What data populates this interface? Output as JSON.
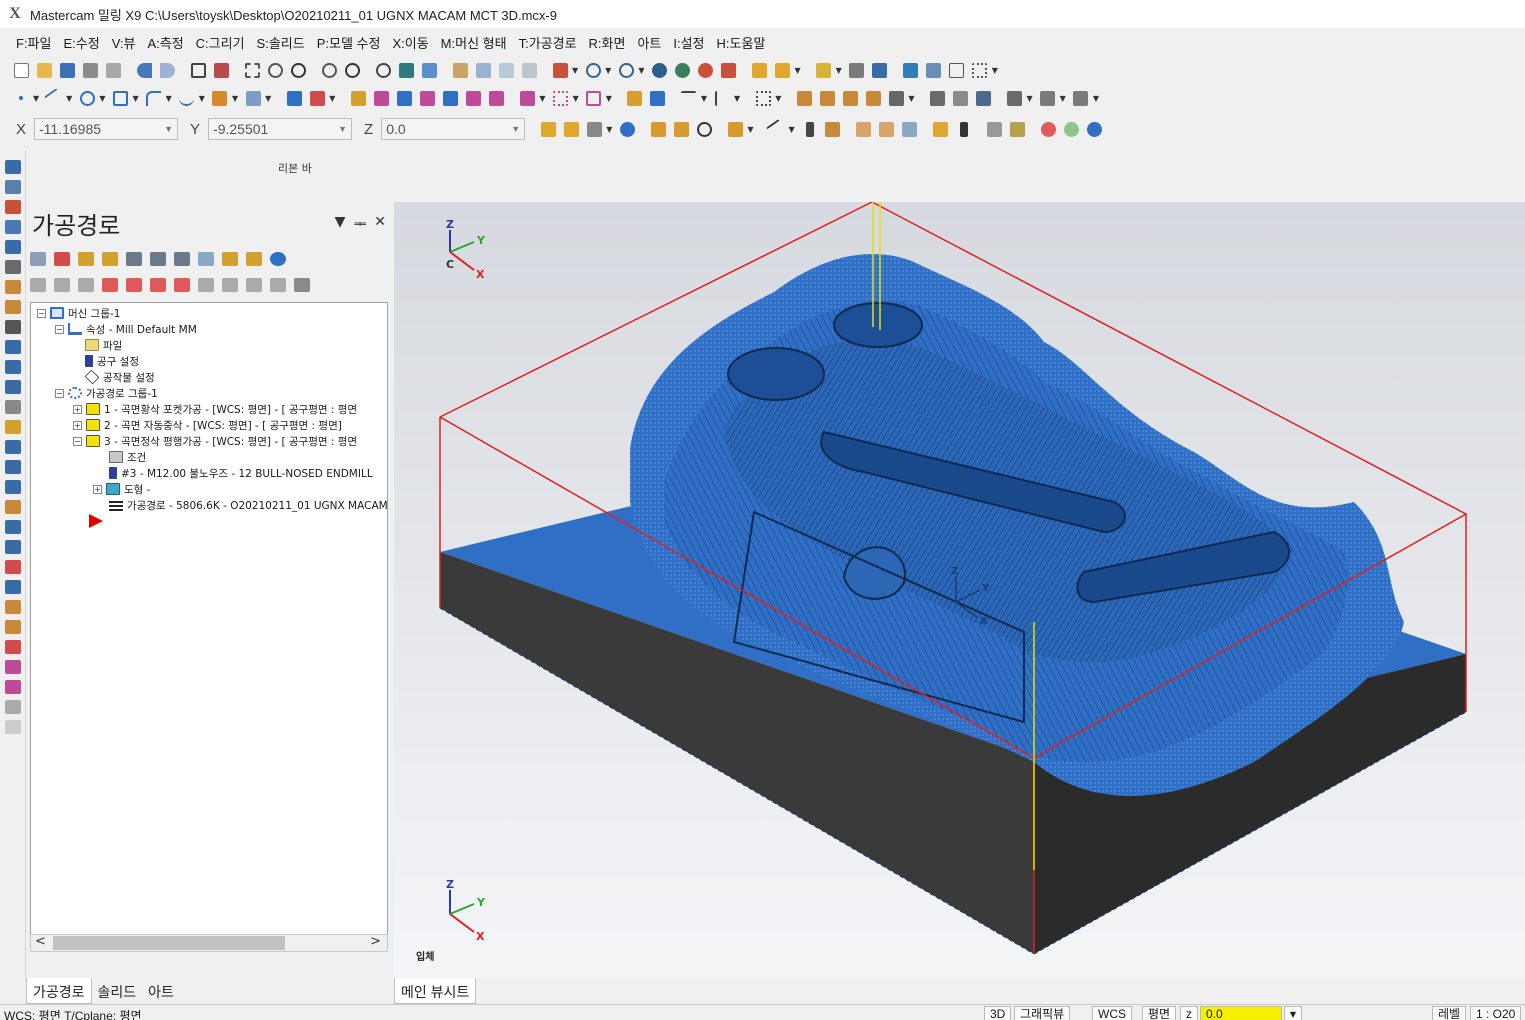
{
  "window": {
    "app_logo": "X",
    "title": "Mastercam 밀링 X9  C:\\Users\\toysk\\Desktop\\O20210211_01 UGNX MACAM MCT 3D.mcx-9"
  },
  "menu": [
    "F:파일",
    "E:수정",
    "V:뷰",
    "A:측정",
    "C:그리기",
    "S:솔리드",
    "P:모델 수정",
    "X:이동",
    "M:머신 형태",
    "T:가공경로",
    "R:화면",
    "아트",
    "I:설정",
    "H:도움말"
  ],
  "coords": {
    "x_label": "X",
    "x_value": "-11.16985",
    "y_label": "Y",
    "y_value": "-9.25501",
    "z_label": "Z",
    "z_value": "0.0"
  },
  "ribbon_label": "리본 바",
  "panel": {
    "title": "가공경로",
    "ctrl_dropdown": "▼",
    "ctrl_pin": "ᆍ",
    "ctrl_close": "✕",
    "tree": [
      {
        "expander": "−",
        "label": "머신 그룹-1"
      },
      {
        "expander": "−",
        "label": "속성 - Mill Default MM"
      },
      {
        "expander": "",
        "label": "파일"
      },
      {
        "expander": "",
        "label": "공구 설정"
      },
      {
        "expander": "",
        "label": "공작물 설정"
      },
      {
        "expander": "−",
        "label": "가공경로 그룹-1"
      },
      {
        "expander": "+",
        "label": "1 - 곡면황삭 포켓가공 - [WCS: 평면] - [ 공구평면 : 평면"
      },
      {
        "expander": "+",
        "label": "2 - 곡면 자동중삭 - [WCS: 평면] - [ 공구평면 : 평면]"
      },
      {
        "expander": "−",
        "label": "3 - 곡면정삭 평행가공 - [WCS: 평면] - [ 공구평면 : 평면"
      },
      {
        "expander": "",
        "label": "조건"
      },
      {
        "expander": "",
        "label": "#3 - M12.00 불노우즈 - 12 BULL-NOSED ENDMILL"
      },
      {
        "expander": "+",
        "label": "도형 -"
      },
      {
        "expander": "",
        "label": "가공경로 - 5806.6K - O20210211_01 UGNX MACAM M"
      }
    ],
    "scroll_left": "<",
    "scroll_right": ">",
    "tabs": [
      "가공경로",
      "솔리드",
      "아트"
    ]
  },
  "viewport": {
    "view_label": "입체",
    "tab": "메인 뷰시트",
    "axis": {
      "x": "X",
      "y": "Y",
      "z": "Z",
      "c": "C"
    },
    "colors": {
      "toolpath": "#2f6fc6",
      "stock_side": "#3a3a3a",
      "boundary": "#e02020",
      "tool": "#e8e000"
    }
  },
  "status": {
    "left": "WCS: 평면  T/Cplane: 평면",
    "buttons": [
      "3D",
      "그래픽뷰",
      "WCS",
      "평면",
      "z",
      "0.0",
      "▾",
      "레벨",
      "1 : O20"
    ]
  }
}
